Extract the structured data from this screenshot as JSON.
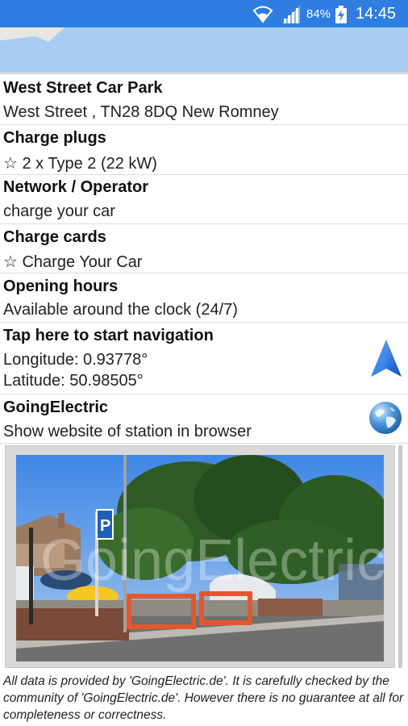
{
  "status_bar": {
    "battery_percent": "84%",
    "time": "14:45",
    "icons": [
      "wifi-icon",
      "signal-icon",
      "battery-charging-icon"
    ],
    "color": "#2f7de1"
  },
  "station": {
    "name": "West Street Car Park",
    "address": "West Street , TN28 8DQ New Romney"
  },
  "charge_plugs": {
    "label": "Charge plugs",
    "value": "☆ 2 x Type 2 (22 kW)"
  },
  "network": {
    "label": "Network / Operator",
    "value": "charge your car"
  },
  "charge_cards": {
    "label": "Charge cards",
    "value": "☆ Charge Your Car"
  },
  "opening_hours": {
    "label": "Opening hours",
    "value": "Available around the clock (24/7)"
  },
  "navigation": {
    "label": "Tap here to start navigation",
    "longitude": "Longitude: 0.93778°",
    "latitude": "Latitude: 50.98505°",
    "icon": "navigation-arrow-icon"
  },
  "website": {
    "label": "GoingElectric",
    "value": "Show website of station in browser",
    "icon": "globe-icon"
  },
  "photo": {
    "watermark": "GoingElectric",
    "sign": "P"
  },
  "disclaimer": "All data is provided by 'GoingElectric.de'. It is carefully checked by the community of 'GoingElectric.de'. However there is no guarantee at all for completeness or correctness."
}
